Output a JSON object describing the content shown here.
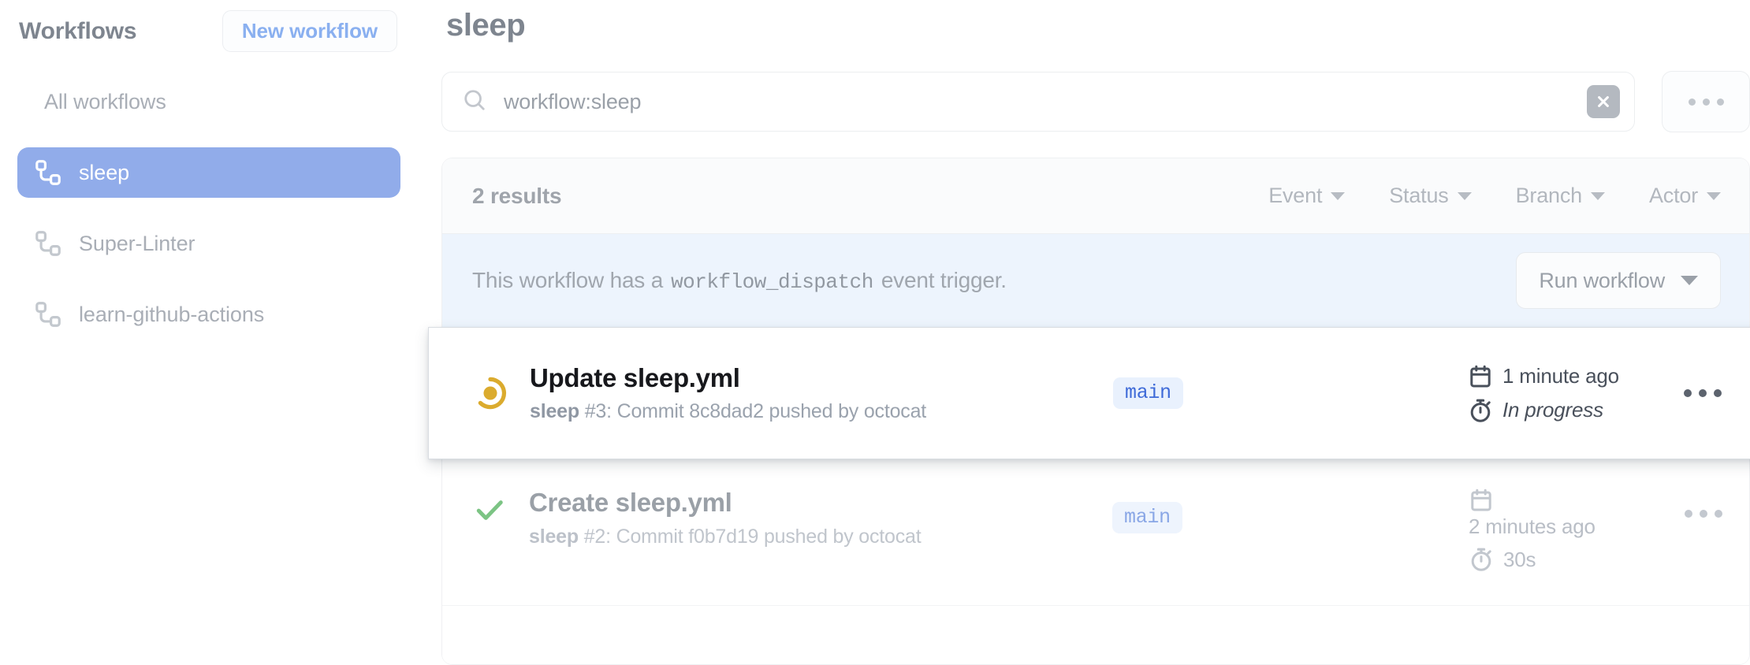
{
  "sidebar": {
    "title": "Workflows",
    "new_workflow_label": "New workflow",
    "items": [
      {
        "label": "All workflows",
        "icon": "",
        "active": false
      },
      {
        "label": "sleep",
        "icon": "workflow-icon",
        "active": true
      },
      {
        "label": "Super-Linter",
        "icon": "workflow-icon",
        "active": false
      },
      {
        "label": "learn-github-actions",
        "icon": "workflow-icon",
        "active": false
      }
    ],
    "active_color": "#91acea",
    "link_color": "#8ab0f0"
  },
  "main": {
    "title": "sleep",
    "search": {
      "value": "workflow:sleep",
      "placeholder": "Filter workflow runs",
      "search_icon": "search-icon",
      "clear_icon": "close-icon"
    },
    "overflow_button": "…"
  },
  "results": {
    "count_label": "2 results",
    "filters": [
      {
        "label": "Event"
      },
      {
        "label": "Status"
      },
      {
        "label": "Branch"
      },
      {
        "label": "Actor"
      }
    ]
  },
  "banner": {
    "text_before": "This workflow has a",
    "code": "workflow_dispatch",
    "text_after": "event trigger.",
    "run_button_label": "Run workflow",
    "background": "#edf4fd"
  },
  "runs": [
    {
      "status": "in_progress",
      "status_icon": "in-progress-icon",
      "status_color": "#dbab2e",
      "title": "Update sleep.yml",
      "workflow_name": "sleep",
      "run_number": "#3",
      "subtitle_rest": ": Commit 8c8dad2 pushed by octocat",
      "branch": "main",
      "time_icon": "calendar-icon",
      "time_label": "1 minute ago",
      "duration_icon": "stopwatch-icon",
      "duration_label": "In progress",
      "duration_italic": true,
      "highlight": true
    },
    {
      "status": "success",
      "status_icon": "check-icon",
      "status_color": "#6fbf73",
      "title": "Create sleep.yml",
      "workflow_name": "sleep",
      "run_number": "#2",
      "subtitle_rest": ": Commit f0b7d19 pushed by octocat",
      "branch": "main",
      "time_icon": "calendar-icon",
      "time_label": "2 minutes ago",
      "duration_icon": "stopwatch-icon",
      "duration_label": "30s",
      "duration_italic": false,
      "highlight": false
    }
  ]
}
